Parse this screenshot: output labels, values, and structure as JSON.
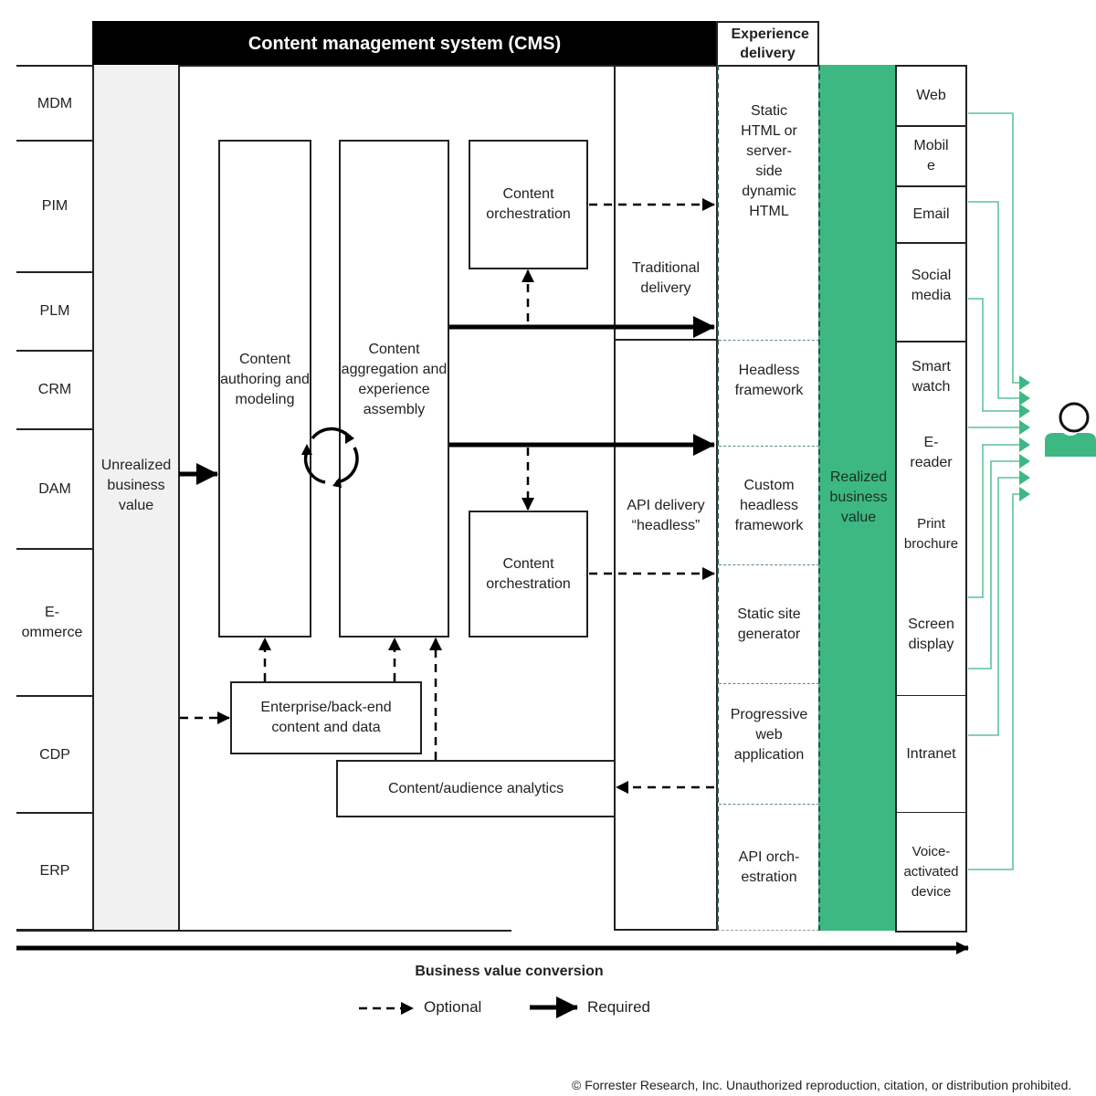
{
  "header": {
    "cms_title": "Content management system (CMS)",
    "experience_title": "Experience delivery"
  },
  "sources": [
    "MDM",
    "PIM",
    "PLM",
    "CRM",
    "DAM",
    "E-\nommerce",
    "CDP",
    "ERP"
  ],
  "unrealized": "Unrealized business value",
  "boxes": {
    "authoring": "Content authoring and modeling",
    "aggregation": "Content aggregation and experience assembly",
    "orchestration_top": "Content orchestration",
    "orchestration_bottom": "Content orchestration",
    "enterprise": "Enterprise/back-end content and data",
    "analytics": "Content/audience analytics"
  },
  "delivery": {
    "traditional": "Traditional delivery",
    "api": "API delivery “headless”"
  },
  "experience_items": [
    "Static HTML or server-side dynamic HTML",
    "Headless framework",
    "Custom headless framework",
    "Static site generator",
    "Progressive web application",
    "API orch-estration"
  ],
  "realized": "Realized business value",
  "channels": [
    "Web",
    "Mobil e",
    "Email",
    "Social media",
    "Smart watch",
    "E-reader",
    "Print brochure",
    "Screen display",
    "Intranet",
    "Voice-activated device"
  ],
  "axis_label": "Business value conversion",
  "legend": {
    "optional": "Optional",
    "required": "Required"
  },
  "footer": "© Forrester Research, Inc. Unauthorized reproduction, citation, or distribution prohibited.",
  "colors": {
    "green": "#3db882",
    "green_line": "#5cc49a",
    "grey": "#f1f1f1",
    "black": "#000000"
  },
  "icons": {
    "user": "user-icon",
    "cycle": "cycle-arrows-icon"
  }
}
